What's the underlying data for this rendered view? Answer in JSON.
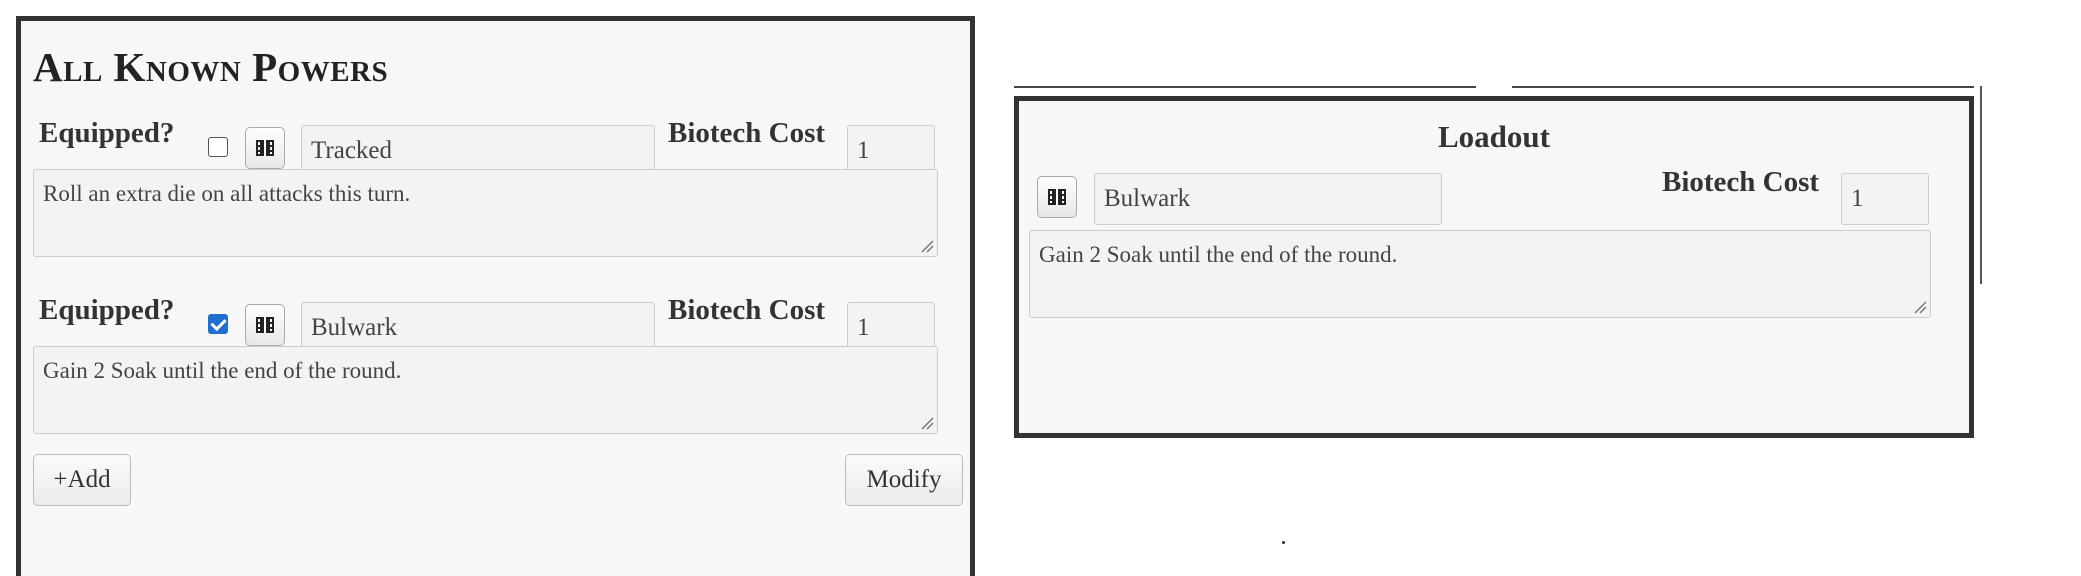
{
  "powers_panel": {
    "title": "All Known Powers",
    "powers": [
      {
        "equipped_label": "Equipped?",
        "equipped": false,
        "name": "Tracked",
        "cost_label": "Biotech Cost",
        "cost": "1",
        "description": "Roll an extra die on all attacks this turn."
      },
      {
        "equipped_label": "Equipped?",
        "equipped": true,
        "name": "Bulwark",
        "cost_label": "Biotech Cost",
        "cost": "1",
        "description": "Gain 2 Soak until the end of the round."
      }
    ],
    "add_button": "+Add",
    "modify_button": "Modify"
  },
  "loadout_panel": {
    "title": "Loadout",
    "item": {
      "name": "Bulwark",
      "cost_label": "Biotech Cost",
      "cost": "1",
      "description": "Gain 2 Soak until the end of the round."
    }
  },
  "colors": {
    "checkbox_checked": "#1f6fd1",
    "panel_border": "#333333",
    "panel_background": "#f7f7f7"
  },
  "icons": {
    "power_icon": "film-strip-icon"
  }
}
